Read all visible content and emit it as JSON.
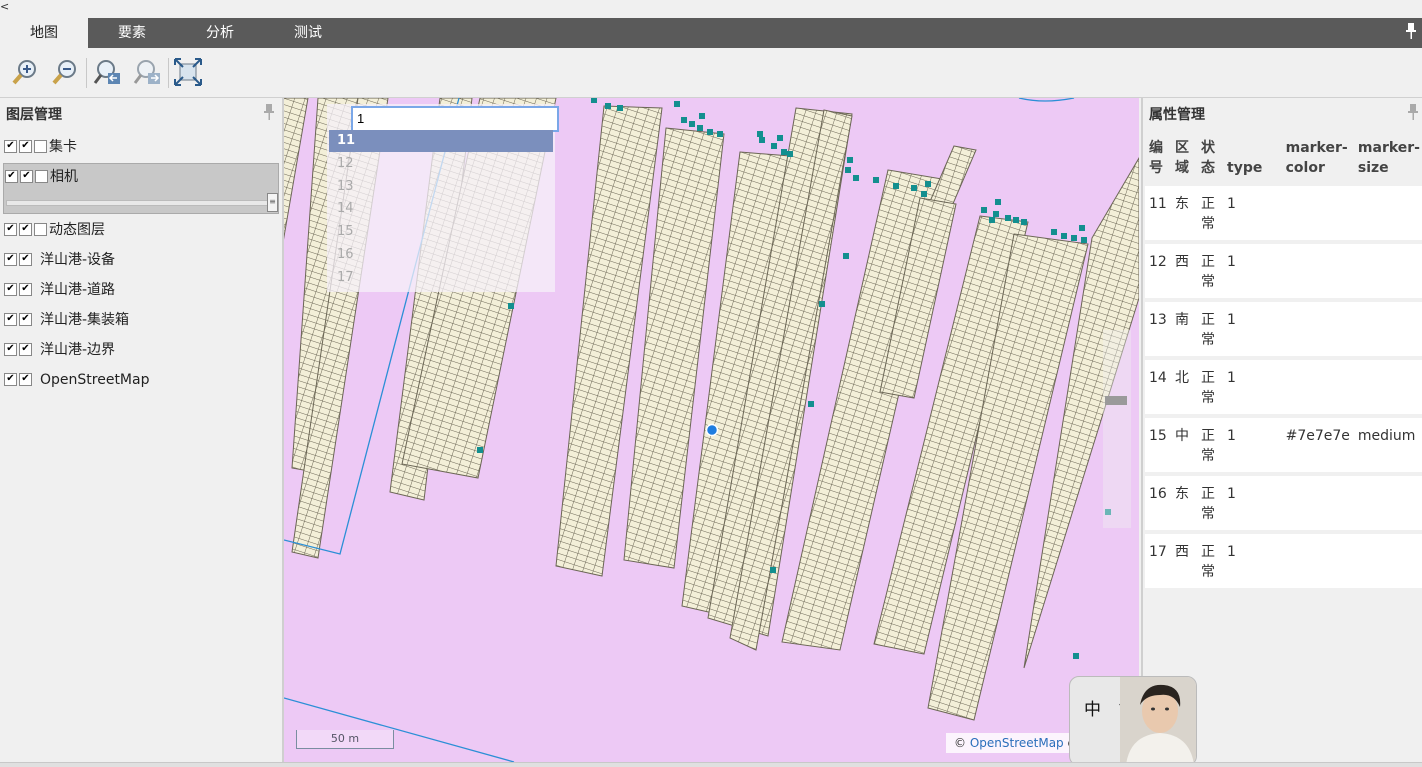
{
  "nav": {
    "back": "<",
    "tabs": [
      {
        "label": "地图"
      },
      {
        "label": "要素"
      },
      {
        "label": "分析"
      },
      {
        "label": "测试"
      }
    ],
    "pin": "📌"
  },
  "toolbar": {
    "tools": [
      "zoom-in-icon",
      "zoom-out-icon",
      "previous-view-icon",
      "next-view-icon",
      "full-extent-icon"
    ]
  },
  "layer_panel": {
    "title": "图层管理",
    "pin": "📌",
    "layers": [
      {
        "label": "集卡",
        "checks": [
          "✔",
          "✔",
          ""
        ]
      },
      {
        "label": "相机",
        "checks": [
          "✔",
          "✔",
          ""
        ]
      },
      {
        "label": "动态图层",
        "checks": [
          "✔",
          "✔",
          ""
        ]
      },
      {
        "label": "洋山港-设备",
        "checks": [
          "✔",
          "✔"
        ]
      },
      {
        "label": "洋山港-道路",
        "checks": [
          "✔",
          "✔"
        ]
      },
      {
        "label": "洋山港-集装箱",
        "checks": [
          "✔",
          "✔"
        ]
      },
      {
        "label": "洋山港-边界",
        "checks": [
          "✔",
          "✔"
        ]
      },
      {
        "label": "OpenStreetMap",
        "checks": [
          "✔",
          "✔"
        ]
      }
    ],
    "slider_handle": "≡"
  },
  "map": {
    "background_color": "#edc9f5",
    "search": {
      "value": "1",
      "options": [
        "11",
        "12",
        "13",
        "14",
        "15",
        "16",
        "17"
      ],
      "selected": "11"
    },
    "scale_label": "50 m",
    "attribution_prefix": "©",
    "attribution_link": "OpenStreetMap",
    "attribution_suffix": "co"
  },
  "attribute_panel": {
    "title": "属性管理",
    "pin": "📌",
    "columns": [
      "编号",
      "区域",
      "状态",
      "type",
      "marker-color",
      "marker-size"
    ],
    "rows": [
      [
        "11",
        "东",
        "正常",
        "1",
        "",
        ""
      ],
      [
        "12",
        "西",
        "正常",
        "1",
        "",
        ""
      ],
      [
        "13",
        "南",
        "正常",
        "1",
        "",
        ""
      ],
      [
        "14",
        "北",
        "正常",
        "1",
        "",
        ""
      ],
      [
        "15",
        "中",
        "正常",
        "1",
        "#7e7e7e",
        "medium"
      ],
      [
        "16",
        "东",
        "正常",
        "1",
        "",
        ""
      ],
      [
        "17",
        "西",
        "正常",
        "1",
        "",
        ""
      ]
    ]
  },
  "ime": {
    "text": "中 简"
  }
}
